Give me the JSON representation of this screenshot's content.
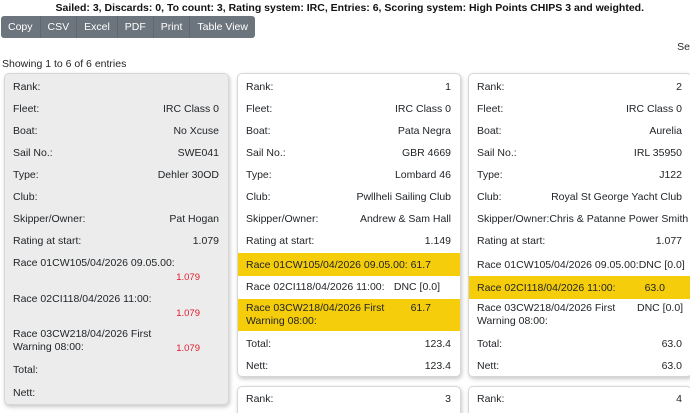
{
  "summary": "Sailed: 3, Discards: 0, To count: 3, Rating system: IRC, Entries: 6, Scoring system: High Points CHIPS 3 and weighted.",
  "toolbar": {
    "buttons": [
      "Copy",
      "CSV",
      "Excel",
      "PDF",
      "Print",
      "Table View"
    ]
  },
  "search_label": "Se",
  "info": "Showing 1 to 6 of 6 entries",
  "labels": {
    "rank": "Rank:",
    "fleet": "Fleet:",
    "boat": "Boat:",
    "sail_no": "Sail No.:",
    "type": "Type:",
    "club": "Club:",
    "skipper": "Skipper/Owner:",
    "rating": "Rating at start:",
    "race1": "Race 01CW105/04/2026 09.05.00:",
    "race2": "Race 02CI118/04/2026 11:00:",
    "race3": "Race 03CW218/04/2026 First Warning 08:00:",
    "total": "Total:",
    "nett": "Nett:"
  },
  "cards": [
    {
      "rank": "",
      "fleet": "IRC Class 0",
      "boat": "No Xcuse",
      "sail_no": "SWE041",
      "type": "Dehler 30OD",
      "club": "",
      "skipper": "Pat Hogan",
      "rating": "1.079",
      "race1": "1.079",
      "race2": "1.079",
      "race3": "1.079",
      "total": "",
      "nett": ""
    },
    {
      "rank": "1",
      "fleet": "IRC Class 0",
      "boat": "Pata Negra",
      "sail_no": "GBR 4669",
      "type": "Lombard 46",
      "club": "Pwllheli Sailing Club",
      "skipper": "Andrew & Sam Hall",
      "rating": "1.149",
      "race1": "61.7",
      "race2": "DNC [0.0]",
      "race3": "61.7",
      "total": "123.4",
      "nett": "123.4"
    },
    {
      "rank": "2",
      "fleet": "IRC Class 0",
      "boat": "Aurelia",
      "sail_no": "IRL 35950",
      "type": "J122",
      "club": "Royal St George Yacht Club",
      "skipper": "Chris & Patanne Power Smith",
      "rating": "1.077",
      "race1": "DNC [0.0]",
      "race2": "63.0",
      "race3": "DNC [0.0]",
      "total": "63.0",
      "nett": "63.0"
    },
    {
      "rank": "3"
    },
    {
      "rank": "4"
    }
  ]
}
